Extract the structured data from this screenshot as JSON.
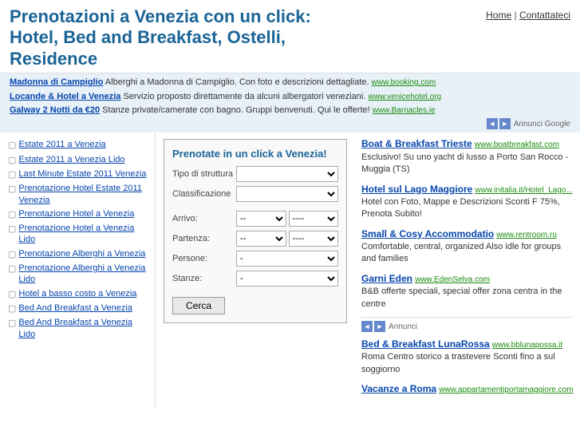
{
  "header": {
    "title": "Prenotazioni a Venezia con un click: Hotel, Bed and Breakfast, Ostelli, Residence",
    "nav_home": "Home",
    "nav_sep": " | ",
    "nav_contact": "Contattateci"
  },
  "adbar": {
    "ads": [
      {
        "title": "Madonna di Campiglio",
        "desc": " Alberghi a Madonna di Campiglio. Con foto e descrizioni dettagliate.",
        "url": "www.booking.com"
      },
      {
        "title": "Locande & Hotel a Venezia",
        "desc": " Servizio proposto direttamente da alcuni albergatori veneziani.",
        "url": "www.venicehotel.org"
      },
      {
        "title": "Galway 2 Notti da €20",
        "desc": " Stanze private/camerate con bagno. Gruppi benvenuti. Qui le offerte!",
        "url": "www.Barnacles.ie"
      }
    ],
    "annunci": "Annunci Google",
    "prev_label": "◄",
    "next_label": "►"
  },
  "sidebar": {
    "items": [
      {
        "label": "Estate 2011 a Venezia"
      },
      {
        "label": "Estate 2011 a Venezia Lido"
      },
      {
        "label": "Last Minute Estate 2011 Venezia"
      },
      {
        "label": "Prenotazione Hotel Estate 2011 Venezia"
      },
      {
        "label": "Prenotazione Hotel a Venezia"
      },
      {
        "label": "Prenotazione Hotel a Venezia Lido"
      },
      {
        "label": "Prenotazione Alberghi a Venezia"
      },
      {
        "label": "Prenotazione Alberghi a Venezia Lido"
      },
      {
        "label": "Hotel a basso costo a Venezia"
      },
      {
        "label": "Bed And Breakfast a Venezia"
      },
      {
        "label": "Bed And Breakfast a Venezia Lido"
      }
    ]
  },
  "form": {
    "title": "Prenotate in un click a Venezia!",
    "tipo_label": "Tipo di struttura",
    "class_label": "Classificazione",
    "arrivo_label": "Arrivo:",
    "partenza_label": "Partenza:",
    "persone_label": "Persone:",
    "stanze_label": "Stanze:",
    "search_btn": "Cerca",
    "day_placeholder": "--",
    "month_placeholder": "----",
    "num_placeholder": "-"
  },
  "right_ads": {
    "annunci": "Annunci",
    "ads_top": [
      {
        "title": "Boat & Breakfast Trieste",
        "url": "www.boatbreakfast.com",
        "desc": "Esclusivo! Su uno yacht di lusso a Porto San Rocco - Muggia (TS)"
      },
      {
        "title": "Hotel sul Lago Maggiore",
        "url": "www.initalia.it/Hotel_Lago...",
        "desc": "Hotel con Foto, Mappe e Descrizioni Sconti F 75%, Prenota Subito!"
      },
      {
        "title": "Small & Cosy Accommodatio",
        "url": "www.rentroom.ru",
        "desc": "Comfortable, central, organized Also idle for groups and families"
      },
      {
        "title": "Garni Eden",
        "url": "www.EdenSelva.com",
        "desc": "B&B offerte speciali, special offer zona centra in the centre"
      }
    ],
    "ads_bottom": [
      {
        "title": "Bed & Breakfast LunaRossa",
        "url": "www.bblunарossa.it",
        "desc": "Roma Centro storico a trastevere Sconti fino a sul soggiorno"
      },
      {
        "title": "Vacanze a Roma",
        "url": "www.appartamentiportamaggiore.com",
        "desc": ""
      }
    ],
    "prev_label": "◄",
    "next_label": "►"
  }
}
